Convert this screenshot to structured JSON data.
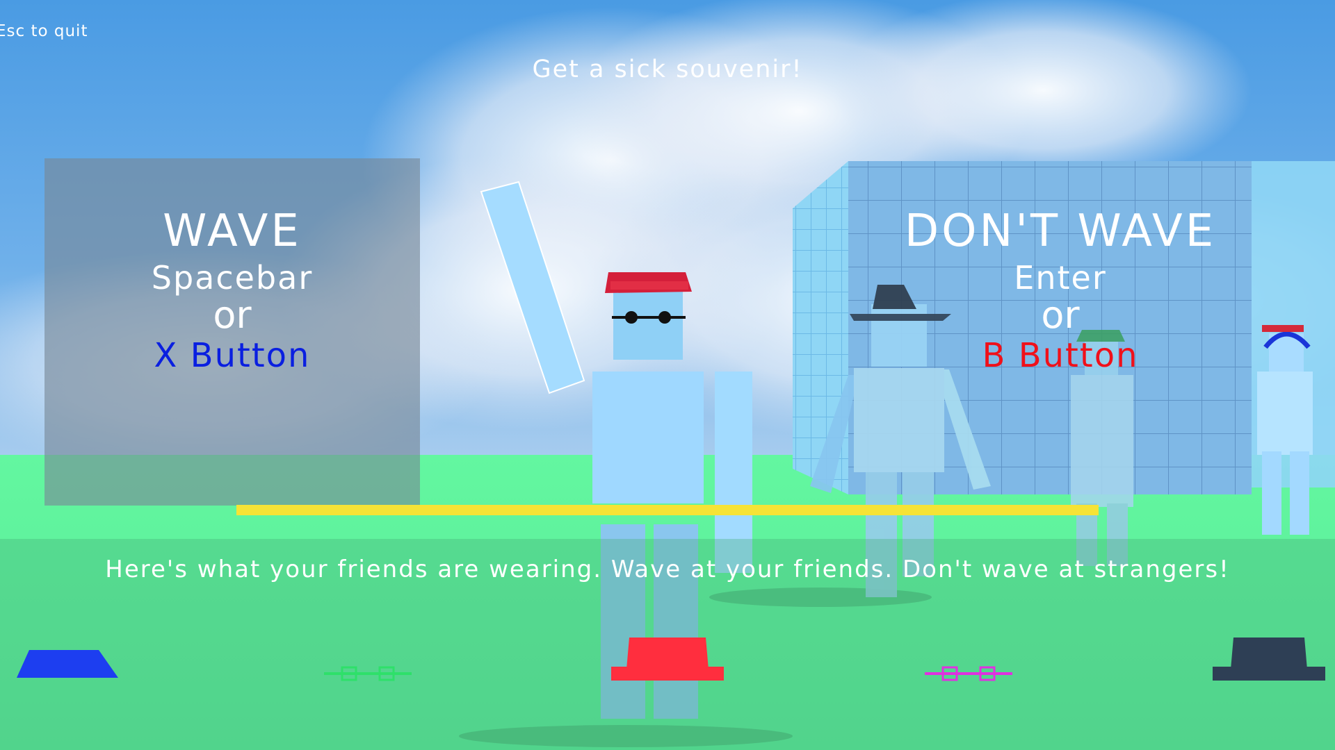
{
  "hud": {
    "quit_hint": "Esc to quit",
    "prompt": "Get a sick souvenir!"
  },
  "wave": {
    "title": "WAVE",
    "key": "Spacebar",
    "or": "or",
    "button": "X Button",
    "button_color": "#0a1fe0"
  },
  "dont_wave": {
    "title": "DON'T WAVE",
    "key": "Enter",
    "or": "or",
    "button": "B Button",
    "button_color": "#f0101a"
  },
  "timer": {
    "color": "#f6e336"
  },
  "instruction": "Here's what your friends are wearing. Wave at your friends. Don't wave at strangers!",
  "friends_items": [
    {
      "icon": "blue-cap-icon",
      "color": "#1d3ef0"
    },
    {
      "icon": "green-glasses-icon",
      "color": "#2ee06a"
    },
    {
      "icon": "red-hat-icon",
      "color": "#ff2e3e"
    },
    {
      "icon": "magenta-glasses-icon",
      "color": "#e030e0"
    },
    {
      "icon": "dark-hat-icon",
      "color": "#2e3f55"
    }
  ]
}
